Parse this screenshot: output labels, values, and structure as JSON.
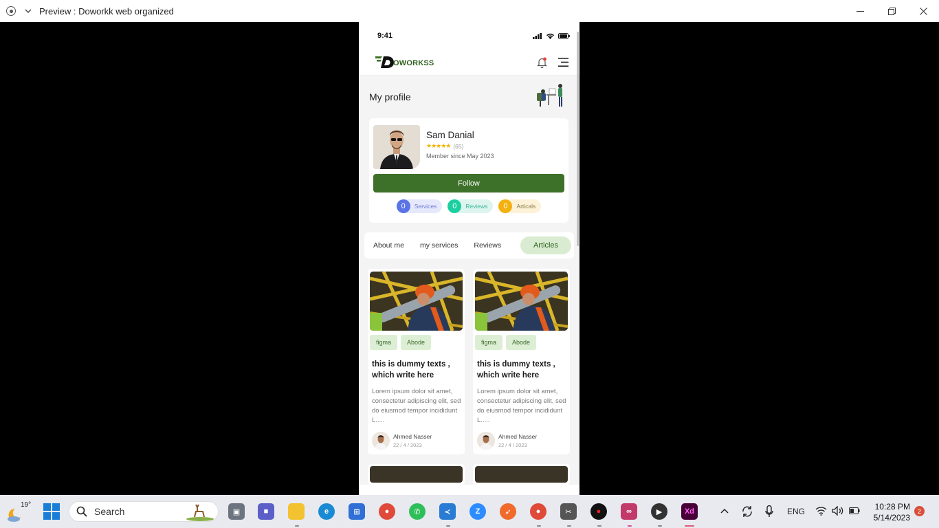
{
  "window": {
    "title": "Preview : Doworkk web organized"
  },
  "status_bar": {
    "time": "9:41"
  },
  "app_bar": {
    "logo_text": "OWORKSS"
  },
  "profile": {
    "section_title": "My profile",
    "name": "Sam Danial",
    "rating_count": "(65)",
    "rating": 5,
    "member_since": "Member since May 2023",
    "follow_label": "Follow",
    "stats": [
      {
        "count": "0",
        "label": "Services"
      },
      {
        "count": "0",
        "label": "Reviews"
      },
      {
        "count": "0",
        "label": "Articals"
      }
    ]
  },
  "tabs": [
    {
      "label": "About me"
    },
    {
      "label": "my services"
    },
    {
      "label": "Reviews"
    },
    {
      "label": "Articles",
      "active": true
    }
  ],
  "articles": [
    {
      "tags": [
        "figma",
        "Abode"
      ],
      "title": "this is dummy texts , which write here",
      "excerpt": "Lorem ipsum dolor sit amet, consectetur adipiscing elit, sed do eiusmod tempor incididunt L.....",
      "author": "Ahmed Nasser",
      "date": "22 / 4 / 2023"
    },
    {
      "tags": [
        "figma",
        "Abode"
      ],
      "title": "this is dummy texts , which write here",
      "excerpt": "Lorem ipsum dolor sit amet, consectetur adipiscing elit, sed do eiusmod tempor incididunt L.....",
      "author": "Ahmed Nasser",
      "date": "22 / 4 / 2023"
    }
  ],
  "taskbar": {
    "weather_temp": "19°",
    "search_label": "Search",
    "language": "ENG",
    "time": "10:28 PM",
    "date": "5/14/2023",
    "notification_count": "2"
  },
  "colors": {
    "brand_green": "#3d7129",
    "active_tab_bg": "#d9ecd1",
    "tag_bg": "#dcefd4",
    "services": "#5a73e6",
    "reviews": "#1ccfa0",
    "articles": "#f3b10f"
  }
}
